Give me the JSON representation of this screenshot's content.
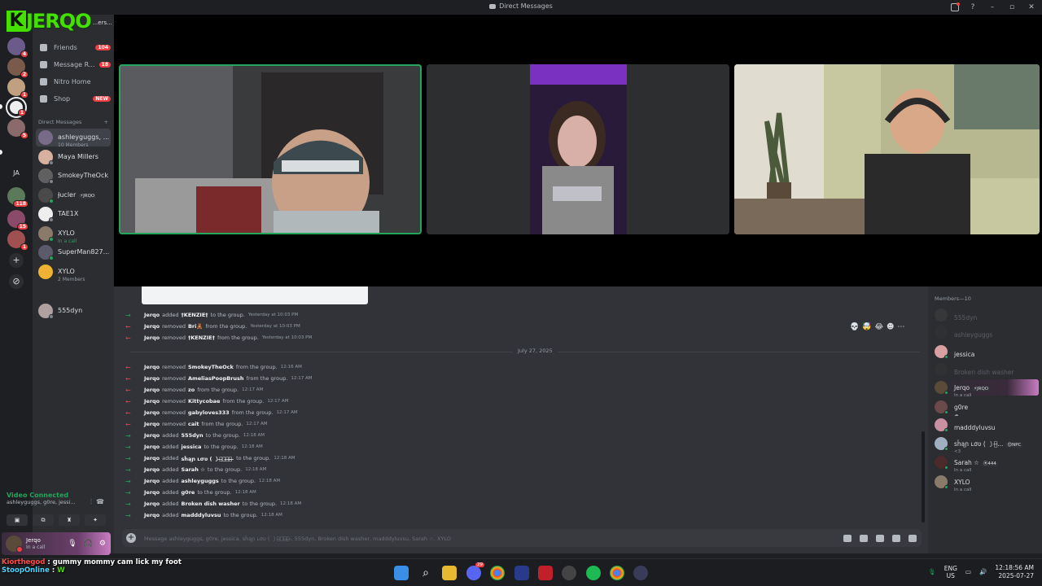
{
  "window": {
    "title": "Direct Messages"
  },
  "stream_logo": {
    "text": "JERQO",
    "k": "K",
    "sub": "...ers..."
  },
  "rail": {
    "badges": [
      "4",
      "2",
      "1",
      "5",
      "118",
      "15",
      "1"
    ],
    "text_server": "JA"
  },
  "nav": {
    "friends": {
      "label": "Friends",
      "badge": "104"
    },
    "message_requests": {
      "label": "Message R...",
      "badge": "18"
    },
    "nitro": {
      "label": "Nitro Home"
    },
    "shop": {
      "label": "Shop",
      "badge": "NEW"
    }
  },
  "dm_header": {
    "label": "Direct Messages",
    "add": "+"
  },
  "dms": [
    {
      "name": "ashleyguggs, ...",
      "sub": "10 Members"
    },
    {
      "name": "Maya Millers",
      "sub": ""
    },
    {
      "name": "SmokeyTheOck",
      "sub": ""
    },
    {
      "name": "Ɉucler",
      "tag": "⚡JRQO",
      "sub": ""
    },
    {
      "name": "TAE1X",
      "sub": ""
    },
    {
      "name": "XYLO",
      "sub": "In a call"
    },
    {
      "name": "SuperMan827...",
      "sub": ""
    },
    {
      "name": "XYLO",
      "sub": "2 Members"
    },
    {
      "name": "555dyn",
      "sub": ""
    }
  ],
  "voice": {
    "status": "Video Connected",
    "channel": "ashleyguggs, g0re, jessi...",
    "buttons": [
      "▣",
      "⧉",
      "♜",
      "✦"
    ]
  },
  "user": {
    "name": "Jerqo",
    "status": "In a call"
  },
  "chat": {
    "entries_top": [
      {
        "type": "add",
        "actor": "Jerqo",
        "verb": "added",
        "target": "†KENZIE†",
        "rest": "to the group.",
        "time": "Yesterday at 10:03 PM"
      },
      {
        "type": "rem",
        "actor": "Jerqo",
        "verb": "removed",
        "target": "Bri🧸",
        "rest": "from the group.",
        "time": "Yesterday at 10:03 PM"
      },
      {
        "type": "rem",
        "actor": "Jerqo",
        "verb": "removed",
        "target": "†KENZIE†",
        "rest": "from the group.",
        "time": "Yesterday at 10:03 PM"
      }
    ],
    "date_divider": "July 27, 2025",
    "entries": [
      {
        "type": "rem",
        "actor": "Jerqo",
        "verb": "removed",
        "target": "SmokeyTheOck",
        "rest": "from the group.",
        "time": "12:16 AM"
      },
      {
        "type": "rem",
        "actor": "Jerqo",
        "verb": "removed",
        "target": "AmeliasPoopBrush",
        "rest": "from the group.",
        "time": "12:17 AM"
      },
      {
        "type": "rem",
        "actor": "Jerqo",
        "verb": "removed",
        "target": "zo",
        "rest": "from the group.",
        "time": "12:17 AM"
      },
      {
        "type": "rem",
        "actor": "Jerqo",
        "verb": "removed",
        "target": "Kittycobae",
        "rest": "from the group.",
        "time": "12:17 AM"
      },
      {
        "type": "rem",
        "actor": "Jerqo",
        "verb": "removed",
        "target": "gabyloves333",
        "rest": "from the group.",
        "time": "12:17 AM"
      },
      {
        "type": "rem",
        "actor": "Jerqo",
        "verb": "removed",
        "target": "cait",
        "rest": "from the group.",
        "time": "12:17 AM"
      },
      {
        "type": "add",
        "actor": "Jerqo",
        "verb": "added",
        "target": "555dyn",
        "rest": "to the group.",
        "time": "12:18 AM"
      },
      {
        "type": "add",
        "actor": "Jerqo",
        "verb": "added",
        "target": "jessica",
        "rest": "to the group.",
        "time": "12:18 AM"
      },
      {
        "type": "add",
        "actor": "Jerqo",
        "verb": "added",
        "target": "sȟąɲ ʟσʋ ( ㇁ﾞ̶ｳﾞ̶ｰ︎̶ ̶̶̶̶",
        "rest": "to the group.",
        "time": "12:18 AM"
      },
      {
        "type": "add",
        "actor": "Jerqo",
        "verb": "added",
        "target": "Sarah ☆",
        "rest": "to the group.",
        "time": "12:18 AM"
      },
      {
        "type": "add",
        "actor": "Jerqo",
        "verb": "added",
        "target": "ashleyguggs",
        "rest": "to the group.",
        "time": "12:18 AM"
      },
      {
        "type": "add",
        "actor": "Jerqo",
        "verb": "added",
        "target": "g0re",
        "rest": "to the group.",
        "time": "12:18 AM"
      },
      {
        "type": "add",
        "actor": "Jerqo",
        "verb": "added",
        "target": "Broken dish washer",
        "rest": "to the group.",
        "time": "12:18 AM"
      },
      {
        "type": "add",
        "actor": "Jerqo",
        "verb": "added",
        "target": "madddyluvsu",
        "rest": "to the group.",
        "time": "12:18 AM"
      }
    ],
    "hover_reactions": [
      "💀",
      "🤯",
      "😂",
      "☻",
      "⋯"
    ],
    "composer_placeholder": "Message ashleyguggs, g0re, jessica, sȟąɲ ʟσʋ ( ㇁ﾞ̶ｳﾞ̶ｰ︎̶ ̶, 555dyn, Broken dish washer, madddyluvsu, Sarah ☆, XYLO"
  },
  "members": {
    "header": "Members—10",
    "list": [
      {
        "name": "555dyn",
        "sub": "",
        "offline": true
      },
      {
        "name": "ashleyguggs",
        "sub": "",
        "offline": true
      },
      {
        "name": "jessica",
        "sub": "",
        "offline": false
      },
      {
        "name": "Broken dish washer",
        "sub": "",
        "offline": true
      },
      {
        "name": "Jerqo",
        "tag": "⚡JRQO",
        "sub": "In a call",
        "offline": false
      },
      {
        "name": "g0re",
        "sub": "☁",
        "offline": false
      },
      {
        "name": "madddyluvsu",
        "sub": "",
        "offline": false
      },
      {
        "name": "sȟąɲ ʟσʋ ( ㇁ﾞ̶...",
        "tag": "😊NPC",
        "sub": "<3",
        "offline": false
      },
      {
        "name": "Sarah ☆",
        "tag": "⦿444",
        "sub": "In a call",
        "offline": false
      },
      {
        "name": "XYLO",
        "sub": "In a call",
        "offline": false
      }
    ]
  },
  "taskbar": {
    "lang_top": "ENG",
    "lang_bottom": "US",
    "time": "12:18:56 AM",
    "date": "2025-07-27",
    "discord_badge": "29"
  },
  "overlay": {
    "user1": "Kiorthegod",
    "msg1": "gummy mommy cam lick my foot",
    "user2": "StoopOnline",
    "msg2": "W"
  },
  "colors": {
    "discord_dark": "#1e1f22",
    "sidebar": "#2b2d31",
    "chat_bg": "#313338",
    "online": "#23a55a",
    "danger": "#f23f42",
    "brand_green": "#43e000"
  }
}
